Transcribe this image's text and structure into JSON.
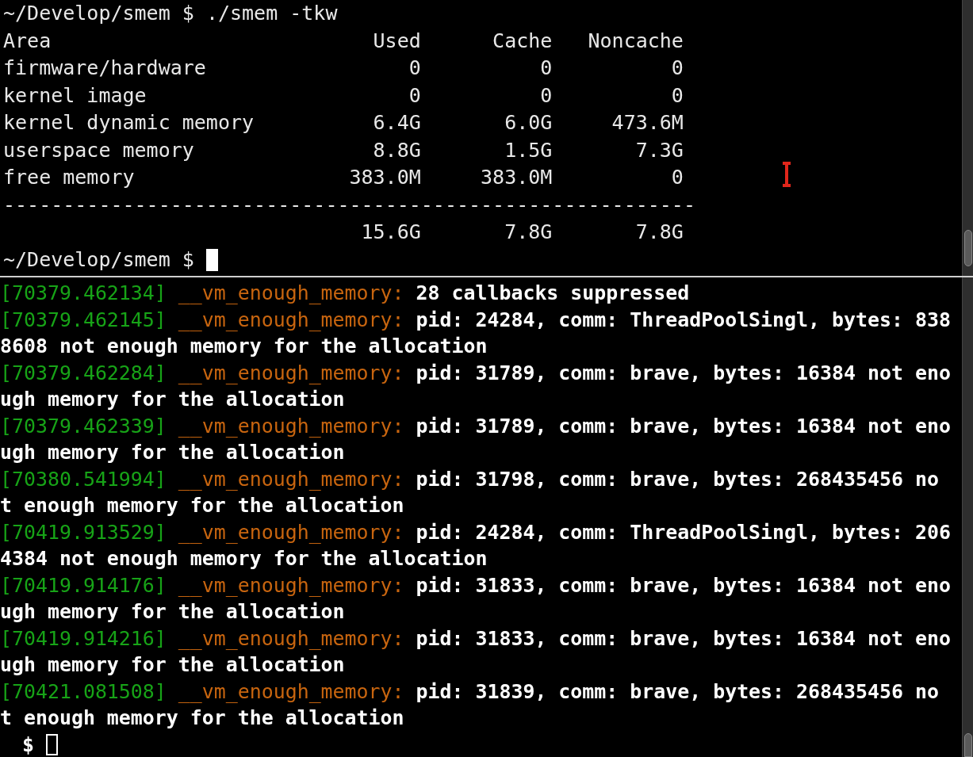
{
  "terminals": [
    {
      "focused": true,
      "command_line": {
        "prompt": "~/Develop/smem $",
        "command": "./smem -tkw"
      },
      "table": {
        "columns": [
          "Area",
          "Used",
          "Cache",
          "Noncache"
        ],
        "rows": [
          [
            "firmware/hardware",
            "0",
            "0",
            "0"
          ],
          [
            "kernel image",
            "0",
            "0",
            "0"
          ],
          [
            "kernel dynamic memory",
            "6.4G",
            "6.0G",
            "473.6M"
          ],
          [
            "userspace memory",
            "8.8G",
            "1.5G",
            "7.3G"
          ],
          [
            "free memory",
            "383.0M",
            "383.0M",
            "0"
          ]
        ],
        "separator": "----------------------------------------------------------",
        "totals": [
          "15.6G",
          "7.8G",
          "7.8G"
        ]
      },
      "prompt": "~/Develop/smem $"
    },
    {
      "focused": false,
      "entries": [
        {
          "timestamp": "[70379.462134]",
          "source": "__vm_enough_memory:",
          "message": "28 callbacks suppressed"
        },
        {
          "timestamp": "[70379.462145]",
          "source": "__vm_enough_memory:",
          "message": "pid: 24284, comm: ThreadPoolSingl, bytes: 8388608 not enough memory for the allocation"
        },
        {
          "timestamp": "[70379.462284]",
          "source": "__vm_enough_memory:",
          "message": "pid: 31789, comm: brave, bytes: 16384 not enough memory for the allocation"
        },
        {
          "timestamp": "[70379.462339]",
          "source": "__vm_enough_memory:",
          "message": "pid: 31789, comm: brave, bytes: 16384 not enough memory for the allocation"
        },
        {
          "timestamp": "[70380.541994]",
          "source": "__vm_enough_memory:",
          "message": "pid: 31798, comm: brave, bytes: 268435456 not enough memory for the allocation"
        },
        {
          "timestamp": "[70419.913529]",
          "source": "__vm_enough_memory:",
          "message": "pid: 24284, comm: ThreadPoolSingl, bytes: 2064384 not enough memory for the allocation"
        },
        {
          "timestamp": "[70419.914176]",
          "source": "__vm_enough_memory:",
          "message": "pid: 31833, comm: brave, bytes: 16384 not enough memory for the allocation"
        },
        {
          "timestamp": "[70419.914216]",
          "source": "__vm_enough_memory:",
          "message": "pid: 31833, comm: brave, bytes: 16384 not enough memory for the allocation"
        },
        {
          "timestamp": "[70421.081508]",
          "source": "__vm_enough_memory:",
          "message": "pid: 31839, comm: brave, bytes: 268435456 not enough memory for the allocation"
        }
      ],
      "prompt": "$"
    }
  ]
}
